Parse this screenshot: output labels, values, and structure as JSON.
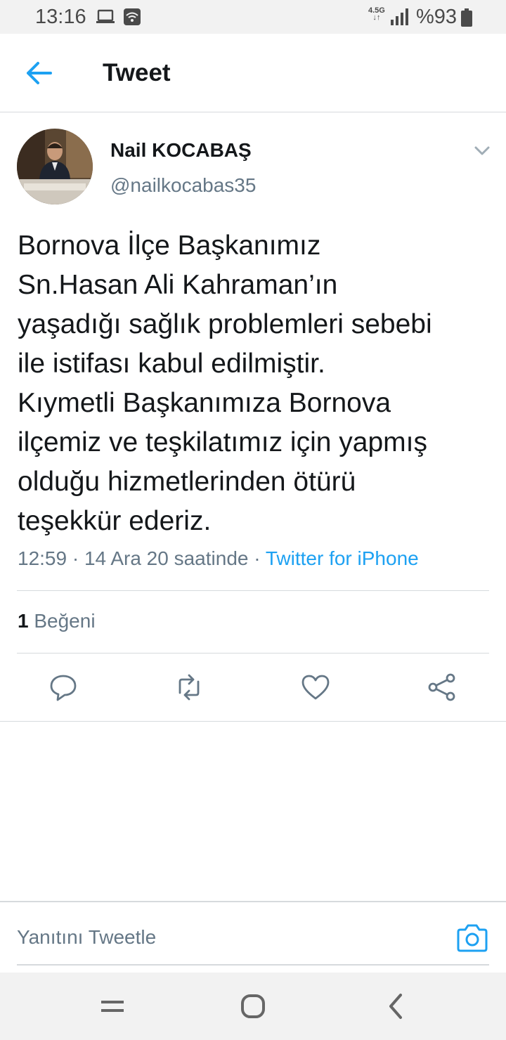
{
  "status_bar": {
    "time": "13:16",
    "network": "4.5G",
    "battery_text": "%93"
  },
  "header": {
    "title": "Tweet"
  },
  "tweet": {
    "author_name": "Nail KOCABAŞ",
    "author_handle": "@nailkocabas35",
    "text": "Bornova İlçe Başkanımız\nSn.Hasan Ali Kahraman’ın\nyaşadığı sağlık problemleri sebebi\nile istifası kabul edilmiştir.\nKıymetli Başkanımıza Bornova\nilçemiz ve teşkilatımız için yapmış\nolduğu hizmetlerinden ötürü\nteşekkür ederiz.",
    "meta_time": "12:59 · 14 Ara 20 saatinde · ",
    "meta_source": "Twitter for iPhone",
    "likes_count": "1",
    "likes_label": " Beğeni"
  },
  "actions": {
    "icons": [
      "reply-icon",
      "retweet-icon",
      "like-icon",
      "share-icon"
    ]
  },
  "reply": {
    "placeholder": "Yanıtını Tweetle"
  },
  "colors": {
    "accent": "#1da1f2",
    "secondary_text": "#657786",
    "primary_text": "#14171a",
    "divider": "#d6dadd"
  }
}
